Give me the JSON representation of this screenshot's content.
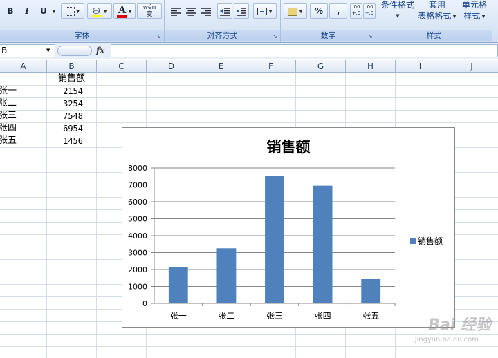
{
  "ribbon": {
    "font_group": {
      "label": "字体",
      "bold": "B",
      "italic": "I",
      "underline": "U",
      "font_color_glyph": "A",
      "phonetic_glyph": "wén 变"
    },
    "align_group": {
      "label": "对齐方式"
    },
    "number_group": {
      "label": "数字",
      "percent": "%",
      "comma": ",",
      "inc_decimal": ".00 +.0",
      "dec_decimal": ".00 +.0"
    },
    "styles_group": {
      "label": "样式",
      "conditional_format": "条件格式",
      "format_table_top": "套用",
      "format_table_bottom": "表格格式",
      "cell_styles_top": "单元格",
      "cell_styles_bottom": "样式"
    }
  },
  "formula_bar": {
    "name_box": "B",
    "fx": "fx",
    "formula": ""
  },
  "columns": [
    "A",
    "B",
    "C",
    "D",
    "E",
    "F",
    "G",
    "H",
    "I",
    "J"
  ],
  "sheet": {
    "header_b": "销售额",
    "rows": [
      {
        "name": "张一",
        "value": "2154"
      },
      {
        "name": "张二",
        "value": "3254"
      },
      {
        "name": "张三",
        "value": "7548"
      },
      {
        "name": "张四",
        "value": "6954"
      },
      {
        "name": "张五",
        "value": "1456"
      }
    ]
  },
  "chart_data": {
    "type": "bar",
    "title": "销售额",
    "categories": [
      "张一",
      "张二",
      "张三",
      "张四",
      "张五"
    ],
    "series": [
      {
        "name": "销售额",
        "values": [
          2154,
          3254,
          7548,
          6954,
          1456
        ],
        "color": "#4f81bd"
      }
    ],
    "ylim": [
      0,
      8000
    ],
    "yticks": [
      0,
      1000,
      2000,
      3000,
      4000,
      5000,
      6000,
      7000,
      8000
    ],
    "grid": true,
    "legend": "right"
  },
  "watermark": {
    "logo": "Bai 经验",
    "url": "jingyan.baidu.com"
  }
}
